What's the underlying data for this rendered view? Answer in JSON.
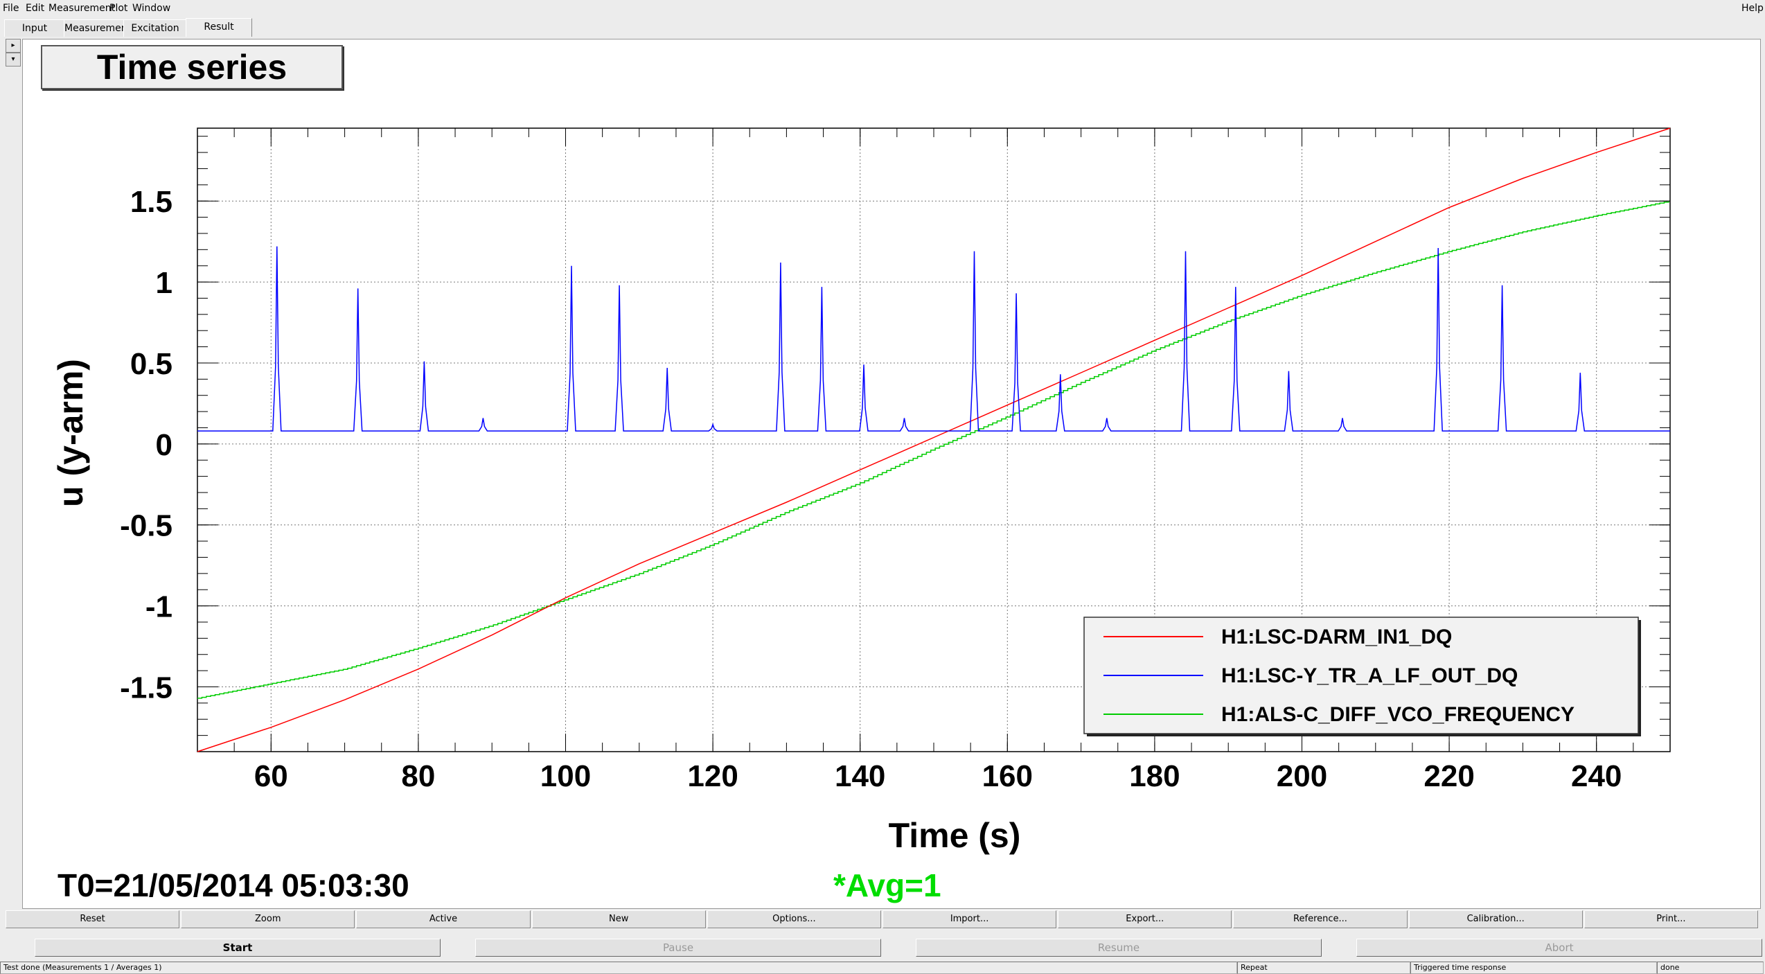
{
  "menu": [
    "File",
    "Edit",
    "Measurement",
    "Plot",
    "Window"
  ],
  "help": "Help",
  "tabs": [
    "Input",
    "Measurement",
    "Excitation",
    "Result"
  ],
  "active_tab": "Result",
  "plot": {
    "title": "Time series",
    "t0": "T0=21/05/2014 05:03:30",
    "avg": "*Avg=1"
  },
  "chart_data": {
    "type": "line",
    "xlabel": "Time (s)",
    "ylabel": "u (y-arm)",
    "xlim": [
      50,
      250
    ],
    "ylim": [
      -1.9,
      1.95
    ],
    "xticks": [
      60,
      80,
      100,
      120,
      140,
      160,
      180,
      200,
      220,
      240
    ],
    "yticks": [
      -1.5,
      -1,
      -0.5,
      0,
      0.5,
      1,
      1.5
    ],
    "ytick_labels": [
      "-1.5",
      "-1",
      "-0.5",
      "0",
      "0.5",
      "1",
      "1.5"
    ],
    "grid": true,
    "legend_position": "bottom-right",
    "series": [
      {
        "name": "H1:LSC-DARM_IN1_DQ",
        "color": "#ff0000",
        "x": [
          50,
          60,
          70,
          80,
          90,
          100,
          110,
          120,
          130,
          140,
          150,
          160,
          170,
          180,
          190,
          200,
          210,
          220,
          230,
          240,
          250
        ],
        "y": [
          -1.9,
          -1.75,
          -1.58,
          -1.39,
          -1.18,
          -0.95,
          -0.74,
          -0.55,
          -0.36,
          -0.16,
          0.04,
          0.24,
          0.44,
          0.64,
          0.84,
          1.04,
          1.25,
          1.46,
          1.64,
          1.8,
          1.95
        ]
      },
      {
        "name": "H1:LSC-Y_TR_A_LF_OUT_DQ",
        "color": "#0000ff",
        "baseline": 0.08,
        "peaks": [
          [
            60.8,
            1.22
          ],
          [
            71.8,
            0.96
          ],
          [
            80.8,
            0.51
          ],
          [
            88.8,
            0.16
          ],
          [
            100.8,
            1.1
          ],
          [
            107.3,
            0.98
          ],
          [
            113.8,
            0.47
          ],
          [
            120,
            0.12
          ],
          [
            129.2,
            1.12
          ],
          [
            134.8,
            0.97
          ],
          [
            140.5,
            0.49
          ],
          [
            146,
            0.16
          ],
          [
            155.5,
            1.19
          ],
          [
            161.2,
            0.93
          ],
          [
            167.2,
            0.43
          ],
          [
            173.5,
            0.16
          ],
          [
            184.2,
            1.19
          ],
          [
            191,
            0.97
          ],
          [
            198.2,
            0.45
          ],
          [
            205.5,
            0.16
          ],
          [
            218.5,
            1.21
          ],
          [
            227.2,
            0.98
          ],
          [
            237.8,
            0.44
          ]
        ]
      },
      {
        "name": "H1:ALS-C_DIFF_VCO_FREQUENCY",
        "color": "#00cc00",
        "x": [
          50,
          60,
          70,
          80,
          90,
          100,
          110,
          120,
          130,
          140,
          150,
          160,
          170,
          180,
          190,
          200,
          210,
          220,
          230,
          240,
          250
        ],
        "y": [
          -1.57,
          -1.48,
          -1.39,
          -1.26,
          -1.12,
          -0.96,
          -0.8,
          -0.62,
          -0.42,
          -0.24,
          -0.03,
          0.17,
          0.38,
          0.58,
          0.76,
          0.92,
          1.06,
          1.19,
          1.31,
          1.41,
          1.5
        ]
      }
    ]
  },
  "buttons_row1": [
    "Reset",
    "Zoom",
    "Active",
    "New",
    "Options...",
    "Import...",
    "Export...",
    "Reference...",
    "Calibration...",
    "Print..."
  ],
  "buttons_row2": [
    {
      "label": "Start",
      "enabled": true
    },
    {
      "label": "Pause",
      "enabled": false
    },
    {
      "label": "Resume",
      "enabled": false
    },
    {
      "label": "Abort",
      "enabled": false
    }
  ],
  "status": [
    "Test done (Measurements 1 / Averages 1)",
    "Repeat",
    "Triggered time response",
    "done"
  ]
}
